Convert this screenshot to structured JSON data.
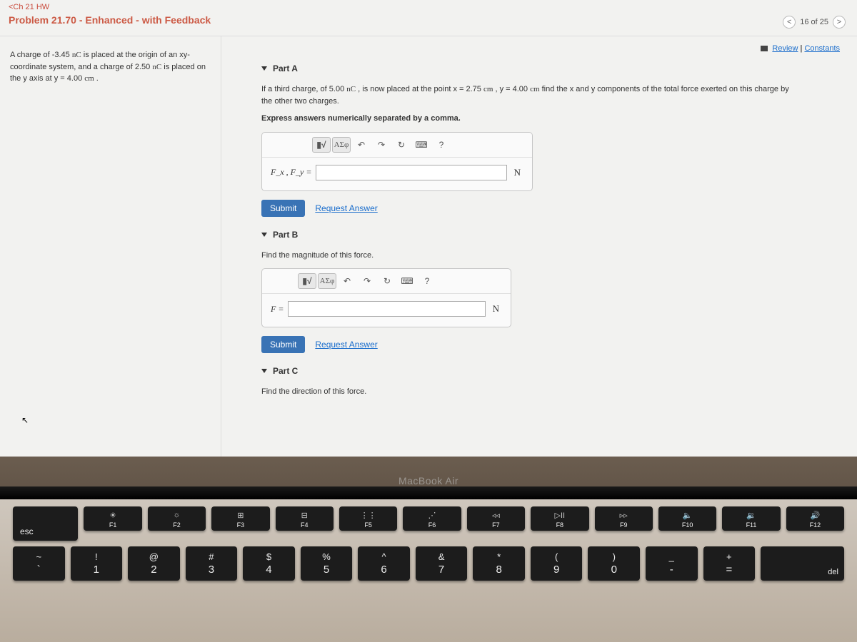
{
  "breadcrumb": "<Ch 21 HW",
  "problem_title": "Problem 21.70 - Enhanced - with Feedback",
  "nav": {
    "prev": "<",
    "counter": "16 of 25",
    "next": ">"
  },
  "review": {
    "review": "Review",
    "sep": " | ",
    "constants": "Constants"
  },
  "sidebar_text": {
    "l1a": "A charge of -3.45 ",
    "l1b": "nC",
    "l1c": " is placed at the origin of an xy-coordinate system, and a charge of 2.50 ",
    "l1d": "nC",
    "l1e": " is placed on the y axis at y = 4.00 ",
    "l1f": "cm",
    "l1g": " ."
  },
  "partA": {
    "title": "Part A",
    "prompt1a": "If a third charge, of 5.00 ",
    "prompt1b": "nC",
    "prompt1c": " , is now placed at the point x = 2.75 ",
    "prompt1d": "cm",
    "prompt1e": " , y = 4.00 ",
    "prompt1f": "cm",
    "prompt1g": " find the x and y components of the total force exerted on this charge by the other two charges.",
    "prompt2": "Express answers numerically separated by a comma.",
    "lhs": "F_x , F_y =",
    "unit": "N",
    "submit": "Submit",
    "request": "Request Answer"
  },
  "partB": {
    "title": "Part B",
    "prompt": "Find the magnitude of this force.",
    "lhs": "F =",
    "unit": "N",
    "submit": "Submit",
    "request": "Request Answer"
  },
  "partC": {
    "title": "Part C",
    "prompt": "Find the direction of this force."
  },
  "tools": {
    "template": "▮√",
    "greek": "ΑΣφ",
    "undo": "↶",
    "redo": "↷",
    "reset": "↻",
    "keyboard": "⌨",
    "help": "?"
  },
  "laptop": {
    "brand": "MacBook Air"
  },
  "keys": {
    "frow": [
      {
        "label": "esc",
        "icon": ""
      },
      {
        "label": "F1",
        "icon": "☀"
      },
      {
        "label": "F2",
        "icon": "☼"
      },
      {
        "label": "F3",
        "icon": "⊞"
      },
      {
        "label": "F4",
        "icon": "⊟"
      },
      {
        "label": "F5",
        "icon": "⋮⋮"
      },
      {
        "label": "F6",
        "icon": "⋰"
      },
      {
        "label": "F7",
        "icon": "◃◃"
      },
      {
        "label": "F8",
        "icon": "▷II"
      },
      {
        "label": "F9",
        "icon": "▹▹"
      },
      {
        "label": "F10",
        "icon": "🔈"
      },
      {
        "label": "F11",
        "icon": "🔉"
      },
      {
        "label": "F12",
        "icon": "🔊"
      }
    ],
    "row2": [
      {
        "u": "~",
        "l": "`"
      },
      {
        "u": "!",
        "l": "1"
      },
      {
        "u": "@",
        "l": "2"
      },
      {
        "u": "#",
        "l": "3"
      },
      {
        "u": "$",
        "l": "4"
      },
      {
        "u": "%",
        "l": "5"
      },
      {
        "u": "^",
        "l": "6"
      },
      {
        "u": "&",
        "l": "7"
      },
      {
        "u": "*",
        "l": "8"
      },
      {
        "u": "(",
        "l": "9"
      },
      {
        "u": ")",
        "l": "0"
      },
      {
        "u": "_",
        "l": "-"
      },
      {
        "u": "+",
        "l": "="
      },
      {
        "u": "",
        "l": "del"
      }
    ]
  }
}
